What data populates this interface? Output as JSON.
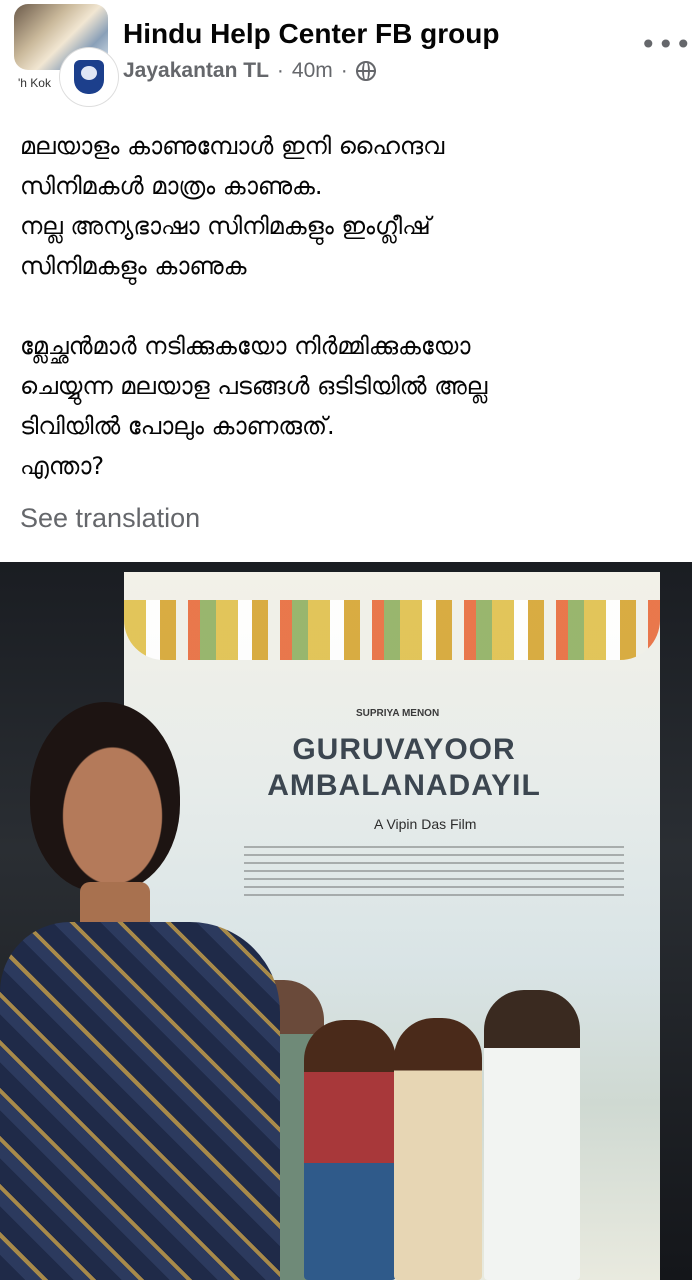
{
  "header": {
    "group_name": "Hindu Help Center FB group",
    "author": "Jayakantan TL",
    "separator": "·",
    "time": "40m",
    "separator2": "·",
    "avatar_tag": "'h Kok",
    "more_label": "•••",
    "icons": [
      "globe-icon",
      "more-options-icon"
    ]
  },
  "post": {
    "paragraph1_lines": [
      "മലയാളം കാണുമ്പോൾ ഇനി ഹൈന്ദവ",
      "സിനിമകൾ മാത്രം കാണുക.",
      "നല്ല അന്യഭാഷാ സിനിമകളും ഇംഗ്ലീഷ്",
      "സിനിമകളും കാണുക"
    ],
    "paragraph2_lines": [
      "മ്ലേച്ഛൻമാർ നടിക്കുകയോ നിർമ്മിക്കുകയോ",
      "ചെയ്യുന്ന മലയാള പടങ്ങൾ ഒടിടിയിൽ അല്ല",
      "ടിവിയിൽ പോലും കാണരുത്.",
      "എന്താ?"
    ],
    "see_translation": "See translation"
  },
  "photo": {
    "poster_presents": "SUPRIYA MENON",
    "poster_title_line1": "GURUVAYOOR",
    "poster_title_line2": "AMBALANADAYIL",
    "poster_byline": "A Vipin Das Film"
  }
}
